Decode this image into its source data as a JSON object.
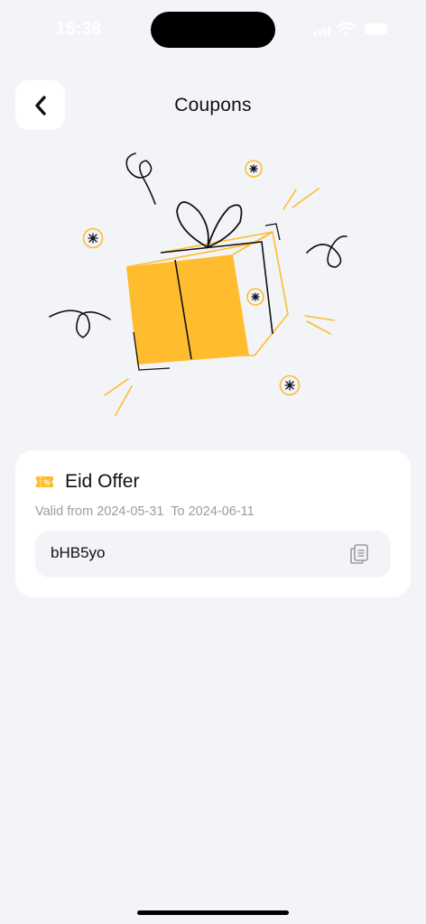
{
  "status_bar": {
    "time": "15:38"
  },
  "header": {
    "title": "Coupons"
  },
  "coupon": {
    "title": "Eid Offer",
    "valid_from_label": "Valid from",
    "valid_from": "2024-05-31",
    "to_label": "To",
    "valid_to": "2024-06-11",
    "code": "bHB5yo"
  },
  "colors": {
    "accent": "#ffbc2e",
    "background": "#f3f4f8",
    "card": "#ffffff",
    "text": "#111111",
    "muted": "#9a9ca3"
  },
  "icons": [
    "back-arrow-icon",
    "coupon-tag-icon",
    "copy-icon",
    "wifi-icon",
    "battery-icon",
    "signal-icon"
  ]
}
